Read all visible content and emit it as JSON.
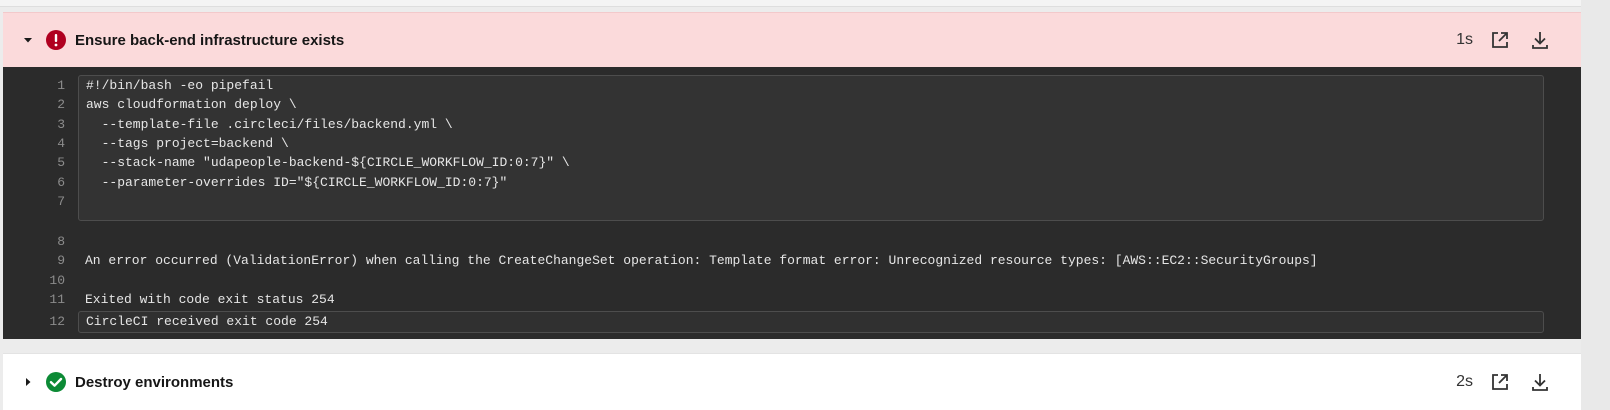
{
  "steps": [
    {
      "title": "Ensure back-end infrastructure exists",
      "status": "failed",
      "duration": "1s",
      "status_color": "#b00020",
      "expanded": true,
      "icons": {
        "caret": "chevron-down-icon",
        "status": "error-icon",
        "open": "open-in-new-icon",
        "download": "download-icon"
      }
    },
    {
      "title": "Destroy environments",
      "status": "success",
      "duration": "2s",
      "status_color": "#0c8a35",
      "expanded": false,
      "icons": {
        "caret": "chevron-right-icon",
        "status": "check-circle-icon",
        "open": "open-in-new-icon",
        "download": "download-icon"
      }
    }
  ],
  "output": {
    "lines": [
      {
        "n": "1",
        "text": "#!/bin/bash -eo pipefail"
      },
      {
        "n": "2",
        "text": "aws cloudformation deploy \\"
      },
      {
        "n": "3",
        "text": "  --template-file .circleci/files/backend.yml \\"
      },
      {
        "n": "4",
        "text": "  --tags project=backend \\"
      },
      {
        "n": "5",
        "text": "  --stack-name \"udapeople-backend-${CIRCLE_WORKFLOW_ID:0:7}\" \\"
      },
      {
        "n": "6",
        "text": "  --parameter-overrides ID=\"${CIRCLE_WORKFLOW_ID:0:7}\""
      },
      {
        "n": "7",
        "text": ""
      },
      {
        "n": "8",
        "text": ""
      },
      {
        "n": "9",
        "text": "An error occurred (ValidationError) when calling the CreateChangeSet operation: Template format error: Unrecognized resource types: [AWS::EC2::SecurityGroups]"
      },
      {
        "n": "10",
        "text": ""
      },
      {
        "n": "11",
        "text": "Exited with code exit status 254"
      },
      {
        "n": "12",
        "text": "CircleCI received exit code 254"
      }
    ]
  }
}
